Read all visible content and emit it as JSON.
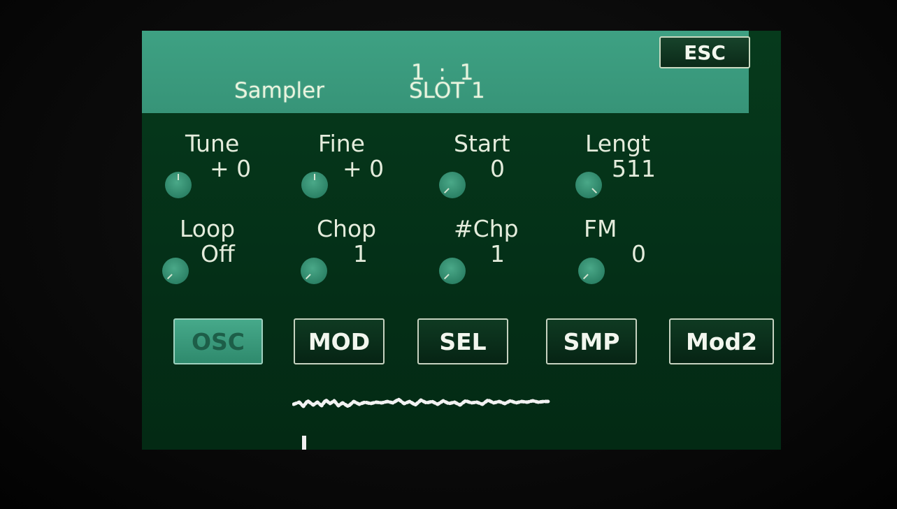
{
  "header": {
    "position": "1  :  1",
    "instrument": "Sampler",
    "slot": "SLOT 1",
    "esc_label": "ESC"
  },
  "params": [
    {
      "label": "Tune",
      "value": "+ 0",
      "knob_level": 0.5
    },
    {
      "label": "Fine",
      "value": "+ 0",
      "knob_level": 0.5
    },
    {
      "label": "Start",
      "value": "0",
      "knob_level": 0.0
    },
    {
      "label": "Lengt",
      "value": "511",
      "knob_level": 1.0
    },
    {
      "label": "Loop",
      "value": "Off",
      "knob_level": 0.0
    },
    {
      "label": "Chop",
      "value": "1",
      "knob_level": 0.0
    },
    {
      "label": "#Chp",
      "value": "1",
      "knob_level": 0.0
    },
    {
      "label": "FM",
      "value": "0",
      "knob_level": 0.0
    }
  ],
  "tabs": [
    {
      "label": "OSC",
      "active": true
    },
    {
      "label": "MOD",
      "active": false
    },
    {
      "label": "SEL",
      "active": false
    },
    {
      "label": "SMP",
      "active": false
    },
    {
      "label": "Mod2",
      "active": false
    }
  ],
  "colors": {
    "header_bg": "#3b9a7e",
    "screen_bg": "#032a14",
    "knob": "#2c8266",
    "text": "#e4ecdc"
  }
}
